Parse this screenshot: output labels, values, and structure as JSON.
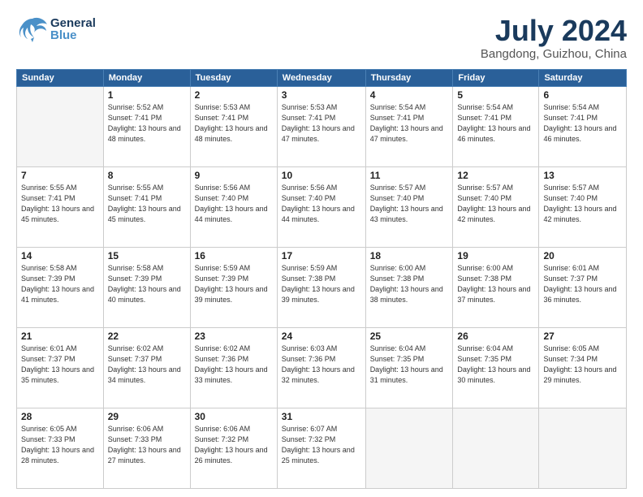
{
  "header": {
    "logo_general": "General",
    "logo_blue": "Blue",
    "title": "July 2024",
    "subtitle": "Bangdong, Guizhou, China"
  },
  "weekdays": [
    "Sunday",
    "Monday",
    "Tuesday",
    "Wednesday",
    "Thursday",
    "Friday",
    "Saturday"
  ],
  "weeks": [
    [
      {
        "day": "",
        "empty": true
      },
      {
        "day": "1",
        "sunrise": "5:52 AM",
        "sunset": "7:41 PM",
        "daylight": "13 hours and 48 minutes."
      },
      {
        "day": "2",
        "sunrise": "5:53 AM",
        "sunset": "7:41 PM",
        "daylight": "13 hours and 48 minutes."
      },
      {
        "day": "3",
        "sunrise": "5:53 AM",
        "sunset": "7:41 PM",
        "daylight": "13 hours and 47 minutes."
      },
      {
        "day": "4",
        "sunrise": "5:54 AM",
        "sunset": "7:41 PM",
        "daylight": "13 hours and 47 minutes."
      },
      {
        "day": "5",
        "sunrise": "5:54 AM",
        "sunset": "7:41 PM",
        "daylight": "13 hours and 46 minutes."
      },
      {
        "day": "6",
        "sunrise": "5:54 AM",
        "sunset": "7:41 PM",
        "daylight": "13 hours and 46 minutes."
      }
    ],
    [
      {
        "day": "7",
        "sunrise": "5:55 AM",
        "sunset": "7:41 PM",
        "daylight": "13 hours and 45 minutes."
      },
      {
        "day": "8",
        "sunrise": "5:55 AM",
        "sunset": "7:41 PM",
        "daylight": "13 hours and 45 minutes."
      },
      {
        "day": "9",
        "sunrise": "5:56 AM",
        "sunset": "7:40 PM",
        "daylight": "13 hours and 44 minutes."
      },
      {
        "day": "10",
        "sunrise": "5:56 AM",
        "sunset": "7:40 PM",
        "daylight": "13 hours and 44 minutes."
      },
      {
        "day": "11",
        "sunrise": "5:57 AM",
        "sunset": "7:40 PM",
        "daylight": "13 hours and 43 minutes."
      },
      {
        "day": "12",
        "sunrise": "5:57 AM",
        "sunset": "7:40 PM",
        "daylight": "13 hours and 42 minutes."
      },
      {
        "day": "13",
        "sunrise": "5:57 AM",
        "sunset": "7:40 PM",
        "daylight": "13 hours and 42 minutes."
      }
    ],
    [
      {
        "day": "14",
        "sunrise": "5:58 AM",
        "sunset": "7:39 PM",
        "daylight": "13 hours and 41 minutes."
      },
      {
        "day": "15",
        "sunrise": "5:58 AM",
        "sunset": "7:39 PM",
        "daylight": "13 hours and 40 minutes."
      },
      {
        "day": "16",
        "sunrise": "5:59 AM",
        "sunset": "7:39 PM",
        "daylight": "13 hours and 39 minutes."
      },
      {
        "day": "17",
        "sunrise": "5:59 AM",
        "sunset": "7:38 PM",
        "daylight": "13 hours and 39 minutes."
      },
      {
        "day": "18",
        "sunrise": "6:00 AM",
        "sunset": "7:38 PM",
        "daylight": "13 hours and 38 minutes."
      },
      {
        "day": "19",
        "sunrise": "6:00 AM",
        "sunset": "7:38 PM",
        "daylight": "13 hours and 37 minutes."
      },
      {
        "day": "20",
        "sunrise": "6:01 AM",
        "sunset": "7:37 PM",
        "daylight": "13 hours and 36 minutes."
      }
    ],
    [
      {
        "day": "21",
        "sunrise": "6:01 AM",
        "sunset": "7:37 PM",
        "daylight": "13 hours and 35 minutes."
      },
      {
        "day": "22",
        "sunrise": "6:02 AM",
        "sunset": "7:37 PM",
        "daylight": "13 hours and 34 minutes."
      },
      {
        "day": "23",
        "sunrise": "6:02 AM",
        "sunset": "7:36 PM",
        "daylight": "13 hours and 33 minutes."
      },
      {
        "day": "24",
        "sunrise": "6:03 AM",
        "sunset": "7:36 PM",
        "daylight": "13 hours and 32 minutes."
      },
      {
        "day": "25",
        "sunrise": "6:04 AM",
        "sunset": "7:35 PM",
        "daylight": "13 hours and 31 minutes."
      },
      {
        "day": "26",
        "sunrise": "6:04 AM",
        "sunset": "7:35 PM",
        "daylight": "13 hours and 30 minutes."
      },
      {
        "day": "27",
        "sunrise": "6:05 AM",
        "sunset": "7:34 PM",
        "daylight": "13 hours and 29 minutes."
      }
    ],
    [
      {
        "day": "28",
        "sunrise": "6:05 AM",
        "sunset": "7:33 PM",
        "daylight": "13 hours and 28 minutes."
      },
      {
        "day": "29",
        "sunrise": "6:06 AM",
        "sunset": "7:33 PM",
        "daylight": "13 hours and 27 minutes."
      },
      {
        "day": "30",
        "sunrise": "6:06 AM",
        "sunset": "7:32 PM",
        "daylight": "13 hours and 26 minutes."
      },
      {
        "day": "31",
        "sunrise": "6:07 AM",
        "sunset": "7:32 PM",
        "daylight": "13 hours and 25 minutes."
      },
      {
        "day": "",
        "empty": true
      },
      {
        "day": "",
        "empty": true
      },
      {
        "day": "",
        "empty": true
      }
    ]
  ]
}
